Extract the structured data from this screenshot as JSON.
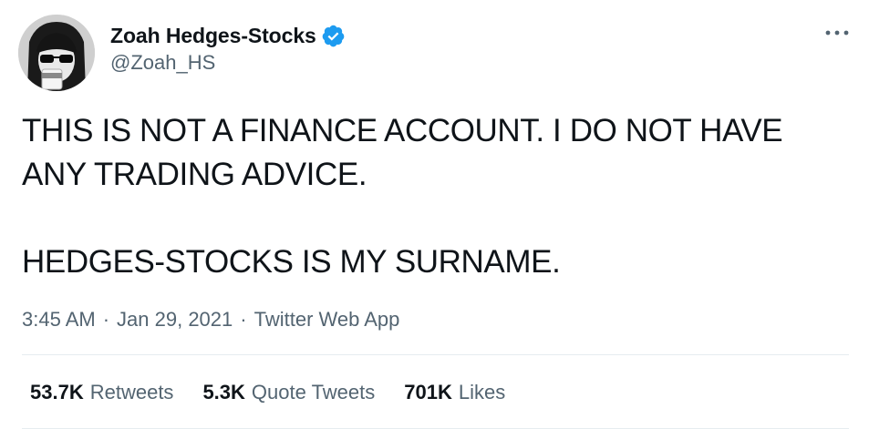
{
  "tweet": {
    "author": {
      "display_name": "Zoah Hedges-Stocks",
      "handle": "@Zoah_HS",
      "verified": true,
      "verified_color": "#1d9bf0"
    },
    "text": "THIS IS NOT A FINANCE ACCOUNT. I DO NOT HAVE\nANY TRADING ADVICE.\n\nHEDGES-STOCKS IS MY SURNAME.",
    "time": "3:45 AM",
    "date": "Jan 29, 2021",
    "source": "Twitter Web App",
    "separator": "·",
    "stats": {
      "retweets": {
        "value": "53.7K",
        "label": "Retweets"
      },
      "quote_tweets": {
        "value": "5.3K",
        "label": "Quote Tweets"
      },
      "likes": {
        "value": "701K",
        "label": "Likes"
      }
    },
    "more_icon": "more-horizontal-icon"
  }
}
